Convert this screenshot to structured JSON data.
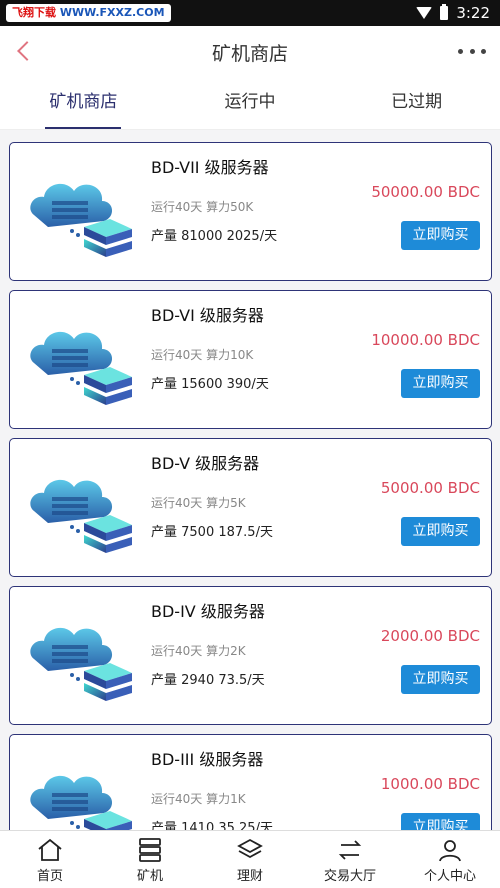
{
  "statusbar": {
    "watermark_left": "飞翔下载",
    "watermark_right": "WWW.FXXZ.COM",
    "time": "3:22"
  },
  "appbar": {
    "title": "矿机商店"
  },
  "tabs": [
    {
      "label": "矿机商店",
      "active": true
    },
    {
      "label": "运行中",
      "active": false
    },
    {
      "label": "已过期",
      "active": false
    }
  ],
  "products": [
    {
      "name": "BD-VII 级服务器",
      "meta": "运行40天 算力50K",
      "yield": "产量 81000   2025/天",
      "price": "50000.00 BDC",
      "buy_label": "立即购买"
    },
    {
      "name": "BD-VI 级服务器",
      "meta": "运行40天 算力10K",
      "yield": "产量 15600   390/天",
      "price": "10000.00 BDC",
      "buy_label": "立即购买"
    },
    {
      "name": "BD-V 级服务器",
      "meta": "运行40天 算力5K",
      "yield": "产量 7500   187.5/天",
      "price": "5000.00 BDC",
      "buy_label": "立即购买"
    },
    {
      "name": "BD-IV 级服务器",
      "meta": "运行40天 算力2K",
      "yield": "产量 2940   73.5/天",
      "price": "2000.00 BDC",
      "buy_label": "立即购买"
    },
    {
      "name": "BD-III 级服务器",
      "meta": "运行40天 算力1K",
      "yield": "产量 1410   35.25/天",
      "price": "1000.00 BDC",
      "buy_label": "立即购买"
    }
  ],
  "bottomnav": [
    {
      "label": "首页",
      "icon": "home-icon"
    },
    {
      "label": "矿机",
      "icon": "server-icon"
    },
    {
      "label": "理财",
      "icon": "layers-icon"
    },
    {
      "label": "交易大厅",
      "icon": "exchange-icon"
    },
    {
      "label": "个人中心",
      "icon": "user-icon"
    }
  ],
  "colors": {
    "accent": "#2b2f6e",
    "price": "#d9485b",
    "button": "#1e8bd8"
  }
}
